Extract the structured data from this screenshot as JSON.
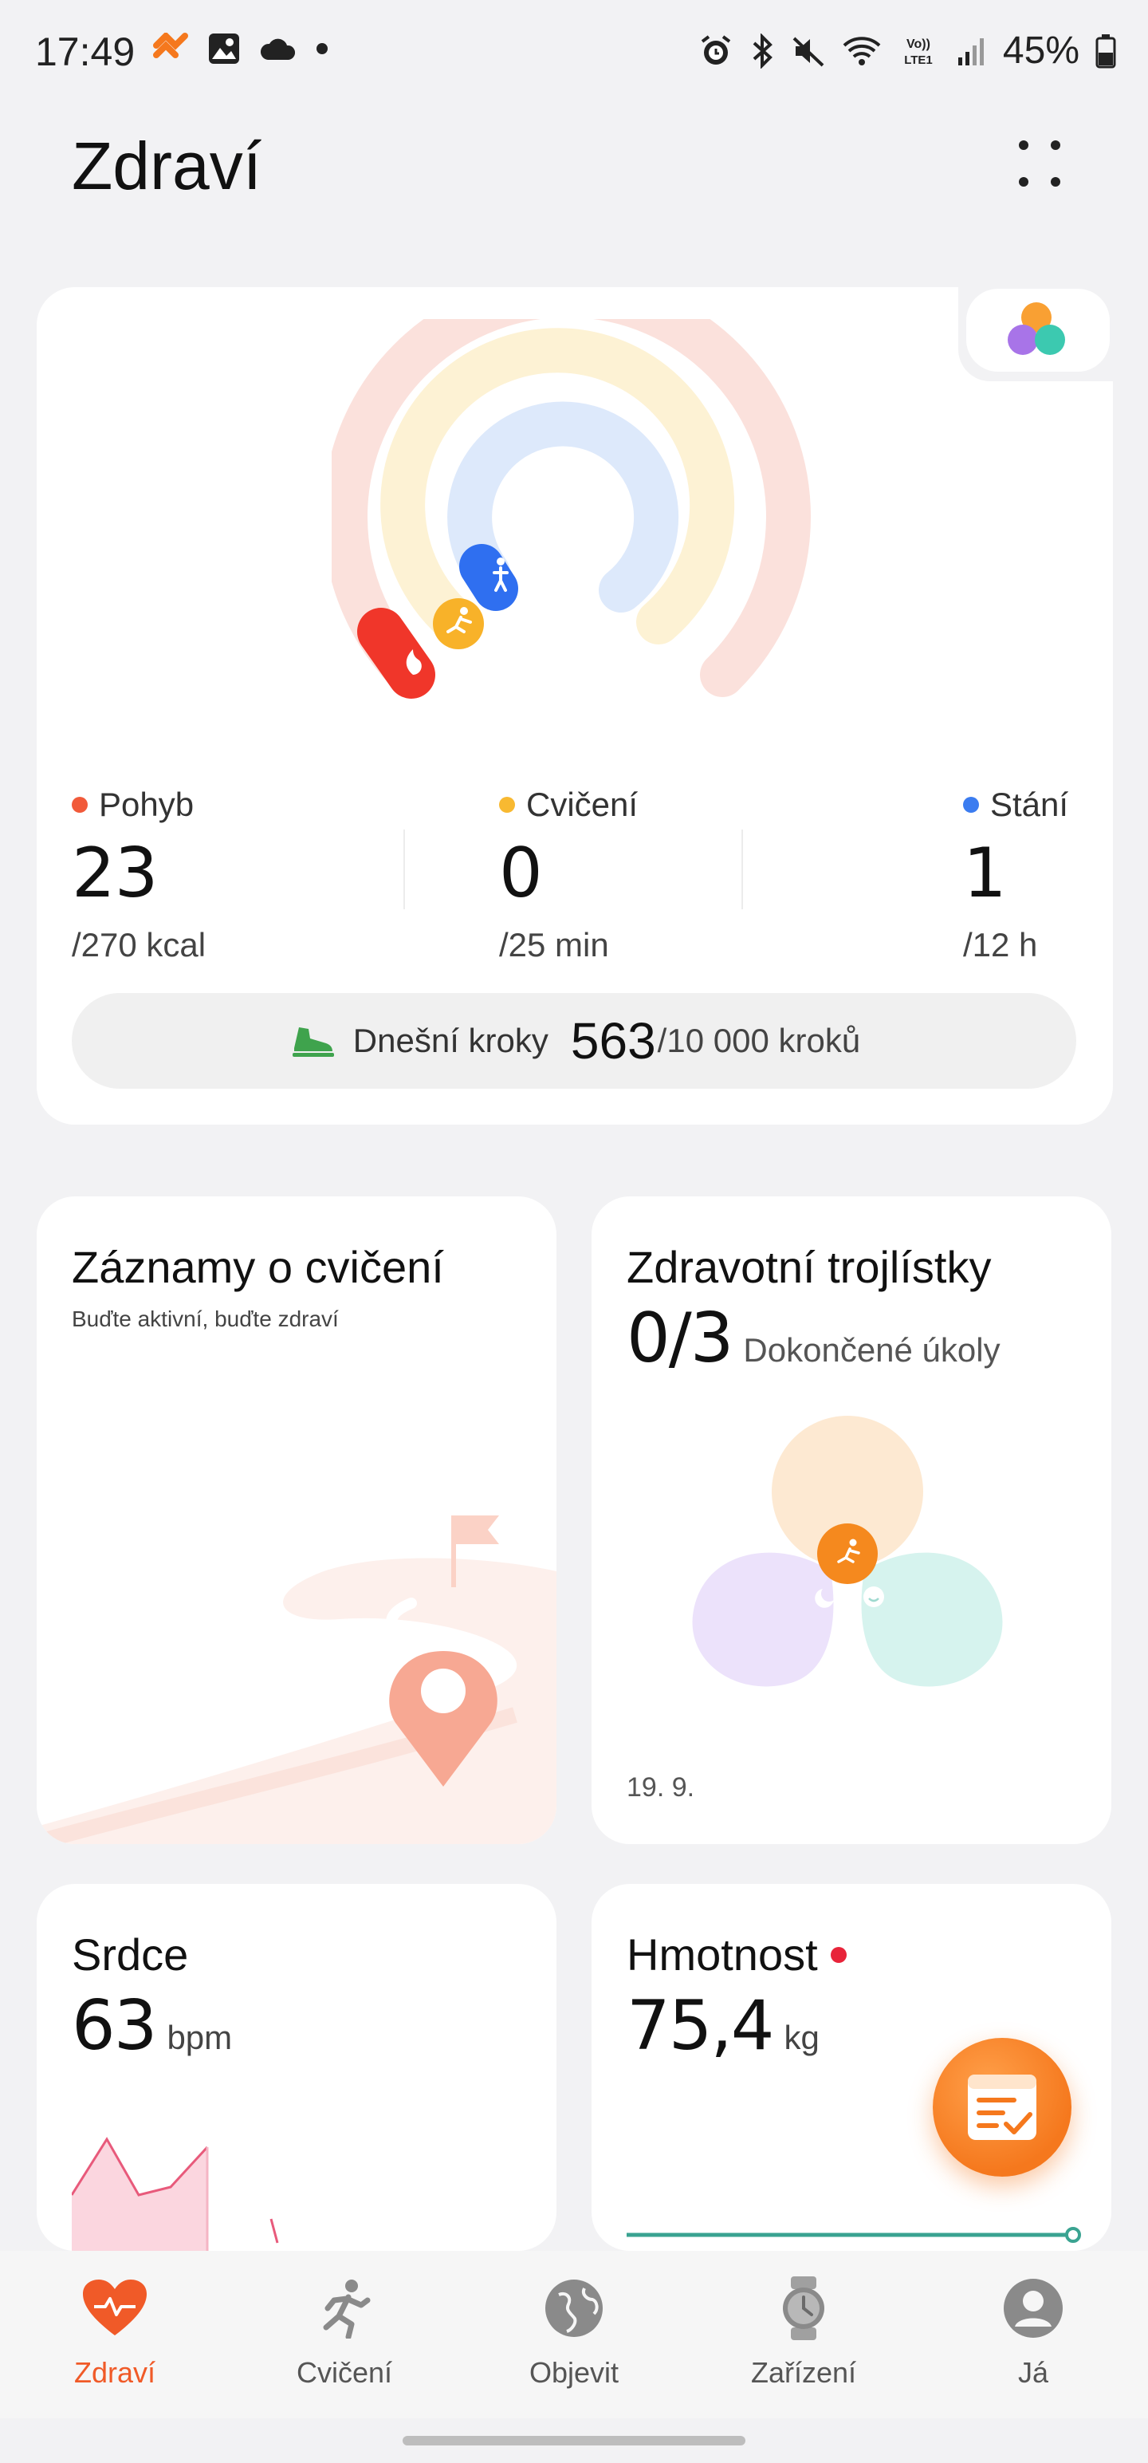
{
  "status_bar": {
    "time": "17:49",
    "battery": "45%",
    "icons": [
      "huawei-health-icon",
      "gallery-icon",
      "weather-icon",
      "dot-icon",
      "alarm-icon",
      "bluetooth-icon",
      "mute-icon",
      "wifi-icon",
      "volte-icon",
      "signal-icon",
      "battery-icon"
    ]
  },
  "header": {
    "title": "Zdraví"
  },
  "activity": {
    "stats": [
      {
        "label": "Pohyb",
        "value": "23",
        "target": "/270 kcal",
        "color": "#f15a3a"
      },
      {
        "label": "Cvičení",
        "value": "0",
        "target": "/25 min",
        "color": "#f8b931"
      },
      {
        "label": "Stání",
        "value": "1",
        "target": "/12 h",
        "color": "#3b7cf0"
      }
    ],
    "rings_progress": {
      "move": 0.085,
      "exercise": 0.0,
      "stand": 0.083
    },
    "steps": {
      "label": "Dnešní kroky",
      "value": "563",
      "target": "/10 000 kroků"
    }
  },
  "exercise_records": {
    "title": "Záznamy o cvičení",
    "subtitle": "Buďte aktivní, buďte zdraví"
  },
  "clovers": {
    "title": "Zdravotní trojlístky",
    "value": "0/3",
    "label": "Dokončené úkoly",
    "date": "19. 9."
  },
  "heart": {
    "title": "Srdce",
    "value": "63",
    "unit": "bpm"
  },
  "weight": {
    "title": "Hmotnost",
    "value": "75,4",
    "unit": "kg"
  },
  "nav": [
    {
      "label": "Zdraví",
      "icon": "heart-icon",
      "active": true
    },
    {
      "label": "Cvičení",
      "icon": "runner-icon",
      "active": false
    },
    {
      "label": "Objevit",
      "icon": "globe-icon",
      "active": false
    },
    {
      "label": "Zařízení",
      "icon": "watch-icon",
      "active": false
    },
    {
      "label": "Já",
      "icon": "profile-icon",
      "active": false
    }
  ]
}
